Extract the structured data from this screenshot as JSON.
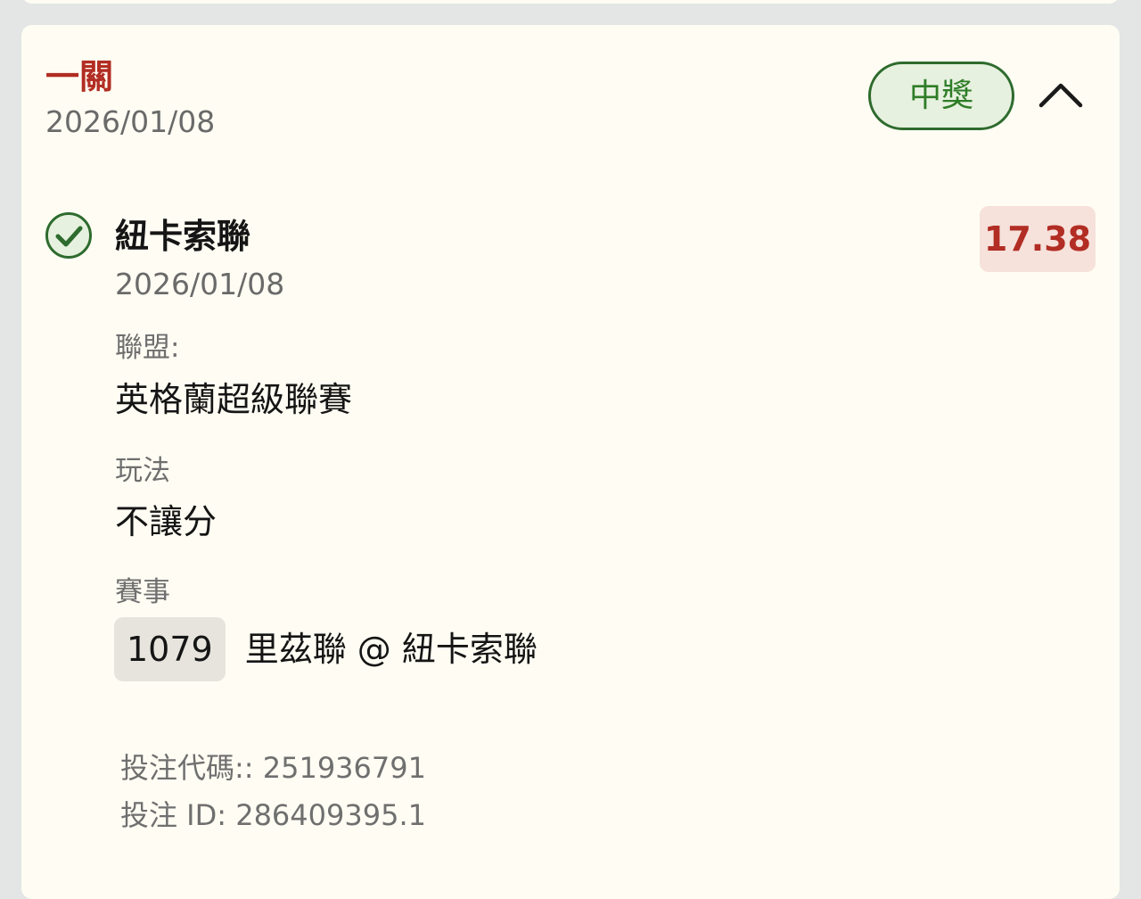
{
  "bet": {
    "type": "一關",
    "date": "2026/01/08",
    "status": "中獎"
  },
  "selection": {
    "name": "紐卡索聯",
    "date": "2026/01/08",
    "odds": "17.38",
    "league_label": "聯盟:",
    "league": "英格蘭超級聯賽",
    "market_label": "玩法",
    "market": "不讓分",
    "event_label": "賽事",
    "event_no": "1079",
    "event_name": "里茲聯 @ 紐卡索聯"
  },
  "footer": {
    "bet_code": "投注代碼:: 251936791",
    "bet_id": "投注 ID: 286409395.1"
  },
  "colors": {
    "accent_red": "#b22d23",
    "win_green": "#2e7d27",
    "card_bg": "#fffdf3"
  },
  "icons": {
    "status_check": "check-circle-icon",
    "collapse": "chevron-up-icon"
  }
}
